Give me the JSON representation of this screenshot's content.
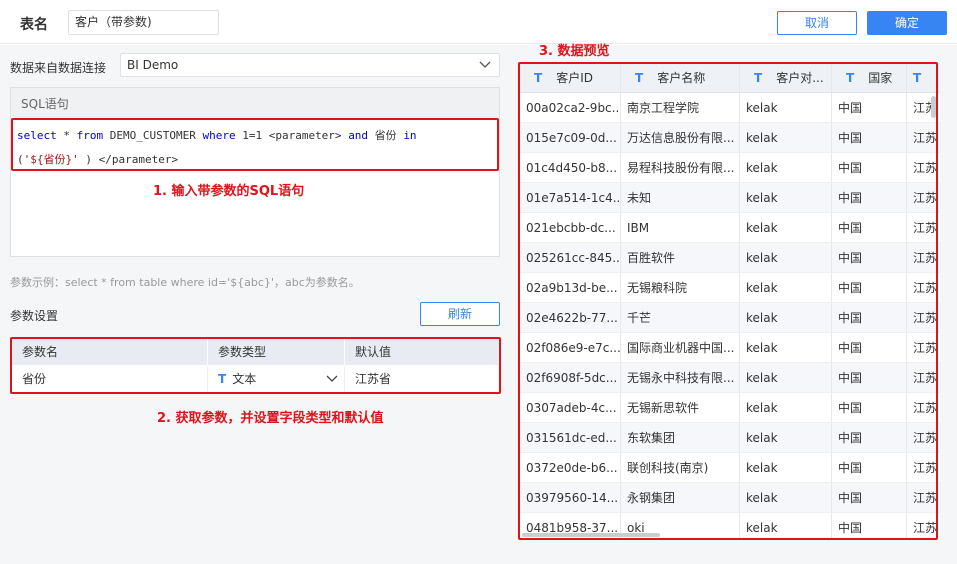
{
  "header": {
    "table_name_label": "表名",
    "table_name_value": "客户（带参数)",
    "cancel_label": "取消",
    "ok_label": "确定"
  },
  "datasource": {
    "label": "数据来自数据连接",
    "selected": "BI Demo"
  },
  "sql": {
    "section_label": "SQL语句",
    "line1": {
      "kw_select": "select",
      "t_star": " * ",
      "kw_from": "from",
      "t_table": " DEMO_CUSTOMER ",
      "kw_where": "where",
      "t_cond": " 1=1 <parameter> ",
      "kw_and": "and",
      "t_field": " 省份 ",
      "kw_in": "in"
    },
    "line2": {
      "t_open": "(",
      "str_param": "'${省份}'",
      "t_close": " ) </parameter>"
    }
  },
  "hint": "参数示例：select * from table where id='${abc}'，abc为参数名。",
  "params": {
    "label": "参数设置",
    "refresh_label": "刷新",
    "columns": [
      "参数名",
      "参数类型",
      "默认值"
    ],
    "row": {
      "name": "省份",
      "type_icon": "T",
      "type": "文本",
      "default": "江苏省"
    }
  },
  "preview": {
    "columns": [
      {
        "icon": "T",
        "label": "客户ID"
      },
      {
        "icon": "T",
        "label": "客户名称"
      },
      {
        "icon": "T",
        "label": "客户对..."
      },
      {
        "icon": "T",
        "label": "国家"
      },
      {
        "icon": "T",
        "label": ""
      }
    ],
    "rows": [
      [
        "00a02ca2-9bc...",
        "南京工程学院",
        "kelak",
        "中国",
        "江苏"
      ],
      [
        "015e7c09-0d...",
        "万达信息股份有限...",
        "kelak",
        "中国",
        "江苏"
      ],
      [
        "01c4d450-b8...",
        "易程科技股份有限...",
        "kelak",
        "中国",
        "江苏"
      ],
      [
        "01e7a514-1c4...",
        "未知",
        "kelak",
        "中国",
        "江苏"
      ],
      [
        "021ebcbb-dc...",
        "IBM",
        "kelak",
        "中国",
        "江苏"
      ],
      [
        "025261cc-845...",
        "百胜软件",
        "kelak",
        "中国",
        "江苏"
      ],
      [
        "02a9b13d-be...",
        "无锡粮科院",
        "kelak",
        "中国",
        "江苏"
      ],
      [
        "02e4622b-77...",
        "千芒",
        "kelak",
        "中国",
        "江苏"
      ],
      [
        "02f086e9-e7c...",
        "国际商业机器中国...",
        "kelak",
        "中国",
        "江苏"
      ],
      [
        "02f6908f-5dc...",
        "无锡永中科技有限...",
        "kelak",
        "中国",
        "江苏"
      ],
      [
        "0307adeb-4c...",
        "无锡新思软件",
        "kelak",
        "中国",
        "江苏"
      ],
      [
        "031561dc-ed...",
        "东软集团",
        "kelak",
        "中国",
        "江苏"
      ],
      [
        "0372e0de-b6...",
        "联创科技(南京)",
        "kelak",
        "中国",
        "江苏"
      ],
      [
        "03979560-14...",
        "永钢集团",
        "kelak",
        "中国",
        "江苏"
      ],
      [
        "0481b958-37...",
        "oki",
        "kelak",
        "中国",
        "江苏"
      ]
    ]
  },
  "annotations": {
    "a1": "1. 输入带参数的SQL语句",
    "a2": "2. 获取参数，并设置字段类型和默认值",
    "a3": "3. 数据预览"
  },
  "colors": {
    "accent": "#3685f2",
    "annotation_red": "#e0131a"
  }
}
